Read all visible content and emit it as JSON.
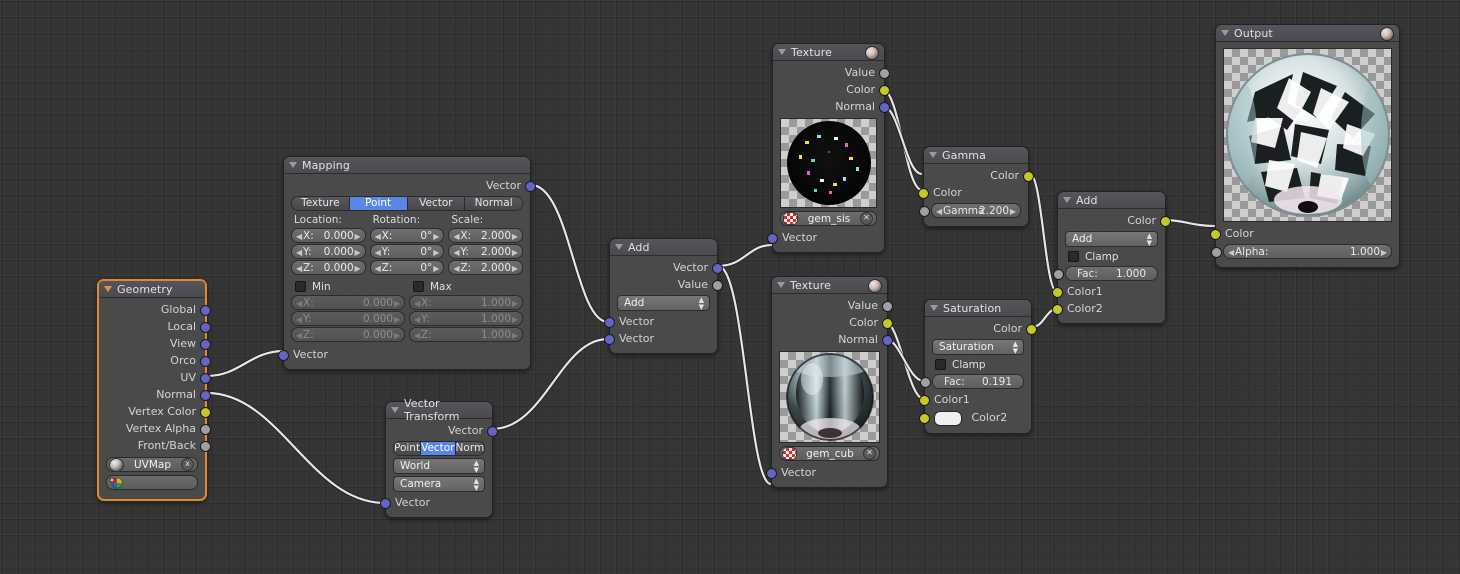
{
  "editor": {
    "name": "blender-node-editor",
    "background_color": "#353535",
    "grid": true,
    "link_color": "#e0e0e0"
  },
  "socket_colors": {
    "vector": "#6363c8",
    "color": "#c7c729",
    "value": "#a0a0a0"
  },
  "accent": {
    "selected_tab": "#5a86e8",
    "active_node_border": "#e8852c"
  },
  "nodes": {
    "geometry": {
      "title": "Geometry",
      "outputs": [
        {
          "label": "Global",
          "type": "vector"
        },
        {
          "label": "Local",
          "type": "vector"
        },
        {
          "label": "View",
          "type": "vector"
        },
        {
          "label": "Orco",
          "type": "vector"
        },
        {
          "label": "UV",
          "type": "vector"
        },
        {
          "label": "Normal",
          "type": "vector"
        },
        {
          "label": "Vertex Color",
          "type": "color"
        },
        {
          "label": "Vertex Alpha",
          "type": "value"
        },
        {
          "label": "Front/Back",
          "type": "value"
        }
      ],
      "uv_field": {
        "value": "UVMap",
        "icon": "uv-sphere-icon",
        "close": "x"
      },
      "color_field": {
        "value": "",
        "icon": "color-palette-icon"
      }
    },
    "mapping": {
      "title": "Mapping",
      "output": {
        "label": "Vector",
        "type": "vector"
      },
      "tabs": [
        "Texture",
        "Point",
        "Vector",
        "Normal"
      ],
      "selected_tab": "Point",
      "location": {
        "label": "Location:",
        "x": "0.000",
        "y": "0.000",
        "z": "0.000",
        "axis": [
          "X:",
          "Y:",
          "Z:"
        ]
      },
      "rotation": {
        "label": "Rotation:",
        "x": "0°",
        "y": "0°",
        "z": "0°",
        "axis": [
          "X:",
          "Y:",
          "Z:"
        ]
      },
      "scale": {
        "label": "Scale:",
        "x": "2.000",
        "y": "2.000",
        "z": "2.000",
        "axis": [
          "X:",
          "Y:",
          "Z:"
        ]
      },
      "min": {
        "label": "Min",
        "checked": false,
        "x": "0.000",
        "y": "0.000",
        "z": "0.000",
        "axis": [
          "X:",
          "Y:",
          "Z:"
        ]
      },
      "max": {
        "label": "Max",
        "checked": false,
        "x": "1.000",
        "y": "1.000",
        "z": "1.000",
        "axis": [
          "X:",
          "Y:",
          "Z:"
        ]
      },
      "input": {
        "label": "Vector",
        "type": "vector"
      }
    },
    "vector_transform": {
      "title": "Vector Transform",
      "output": {
        "label": "Vector",
        "type": "vector"
      },
      "tabs": [
        "Point",
        "Vector",
        "Norm"
      ],
      "selected_tab": "Vector",
      "convert_from": "World",
      "convert_to": "Camera",
      "input": {
        "label": "Vector",
        "type": "vector"
      }
    },
    "vector_math_add": {
      "title": "Add",
      "outputs": [
        {
          "label": "Vector",
          "type": "vector"
        },
        {
          "label": "Value",
          "type": "value"
        }
      ],
      "operation": "Add",
      "inputs": [
        {
          "label": "Vector",
          "type": "vector"
        },
        {
          "label": "Vector",
          "type": "vector"
        }
      ]
    },
    "texture_top": {
      "title": "Texture",
      "outputs": [
        {
          "label": "Value",
          "type": "value"
        },
        {
          "label": "Color",
          "type": "color"
        },
        {
          "label": "Normal",
          "type": "vector"
        }
      ],
      "texture_name": "gem_sis",
      "input": {
        "label": "Vector",
        "type": "vector"
      }
    },
    "texture_bottom": {
      "title": "Texture",
      "outputs": [
        {
          "label": "Value",
          "type": "value"
        },
        {
          "label": "Color",
          "type": "color"
        },
        {
          "label": "Normal",
          "type": "vector"
        }
      ],
      "texture_name": "gem_cub",
      "input": {
        "label": "Vector",
        "type": "vector"
      }
    },
    "gamma": {
      "title": "Gamma",
      "output": {
        "label": "Color",
        "type": "color"
      },
      "input_color": {
        "label": "Color",
        "type": "color"
      },
      "gamma_label": "Gamma",
      "gamma_value": "2.200"
    },
    "saturation": {
      "title": "Saturation",
      "output": {
        "label": "Color",
        "type": "color"
      },
      "blend_mode": "Saturation",
      "clamp": {
        "label": "Clamp",
        "checked": false
      },
      "fac": {
        "label": "Fac:",
        "value": "0.191"
      },
      "color1": {
        "label": "Color1",
        "type": "color"
      },
      "color2": {
        "label": "Color2",
        "type": "color",
        "swatch": "#eeeeee"
      }
    },
    "mix_add": {
      "title": "Add",
      "output": {
        "label": "Color",
        "type": "color"
      },
      "blend_mode": "Add",
      "clamp": {
        "label": "Clamp",
        "checked": false
      },
      "fac": {
        "label": "Fac:",
        "value": "1.000"
      },
      "color1": {
        "label": "Color1",
        "type": "color"
      },
      "color2": {
        "label": "Color2",
        "type": "color"
      }
    },
    "output": {
      "title": "Output",
      "color_input": {
        "label": "Color",
        "type": "color"
      },
      "alpha": {
        "label": "Alpha:",
        "value": "1.000"
      }
    }
  }
}
